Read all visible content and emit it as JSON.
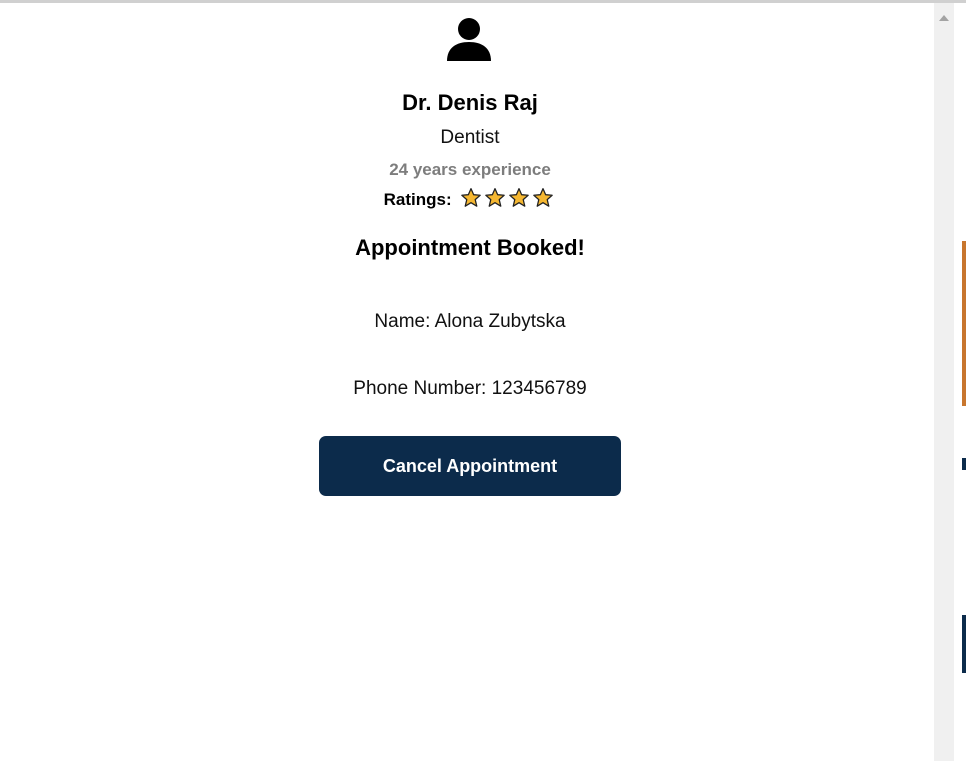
{
  "doctor": {
    "name": "Dr. Denis Raj",
    "specialty": "Dentist",
    "experience": "24 years experience",
    "ratings_label": "Ratings:",
    "rating_stars": 4
  },
  "appointment": {
    "title": "Appointment Booked!",
    "name_line": "Name: Alona Zubytska",
    "phone_line": "Phone Number: 123456789",
    "cancel_label": "Cancel Appointment"
  },
  "icons": {
    "avatar": "user-icon",
    "star": "star-icon",
    "scroll_up": "scroll-up-arrow"
  },
  "colors": {
    "button_bg": "#0c2b4b",
    "star_fill": "#f5b731",
    "experience_text": "#7d7d7d"
  }
}
